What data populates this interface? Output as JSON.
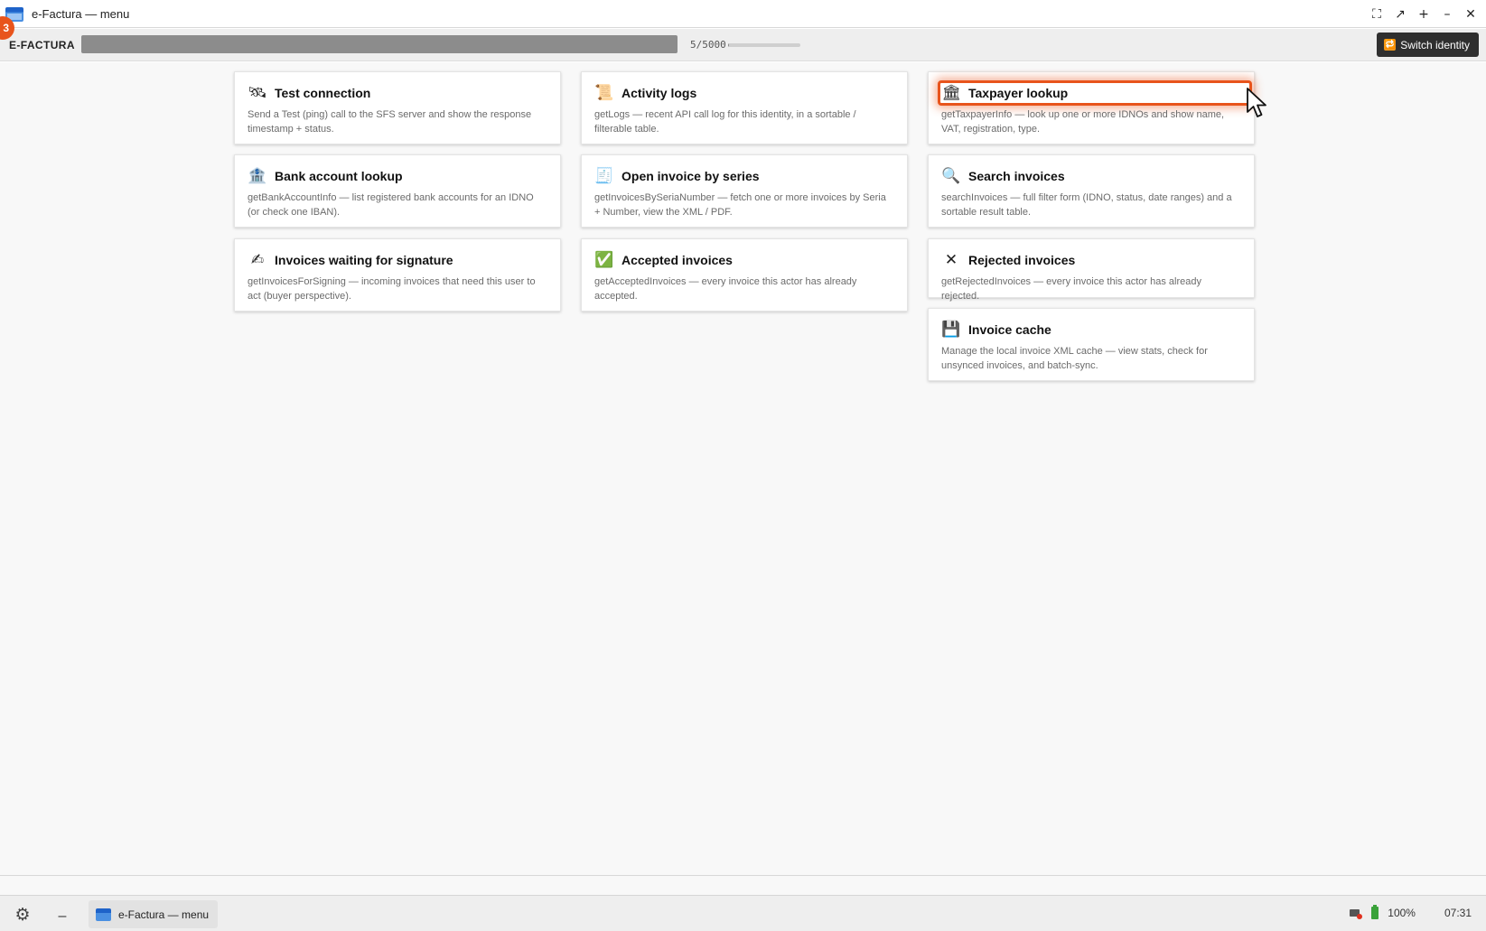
{
  "window": {
    "title": "e-Factura — menu",
    "icon": "folder-icon",
    "controls": {
      "fullscreen_icon": "⛶",
      "unmaximize_icon": "↗",
      "add_icon": "+",
      "minimize_icon": "–",
      "close_icon": "✕"
    }
  },
  "notification": {
    "badge": "3",
    "color": "#e8541c"
  },
  "appbar": {
    "brand": "E-FACTURA",
    "quota_text": "5/5000",
    "quota_fraction": 0.001,
    "switch_identity": {
      "icon": "🔁",
      "label": "Switch identity"
    }
  },
  "accent_color": "#e8541c",
  "cards": [
    {
      "id": "test-connection",
      "icon": "🛰",
      "title": "Test connection",
      "description": "Send a Test (ping) call to the SFS server and show the response timestamp + status."
    },
    {
      "id": "activity-logs",
      "icon": "📜",
      "title": "Activity logs",
      "description": "getLogs — recent API call log for this identity, in a sortable / filterable table."
    },
    {
      "id": "taxpayer-lookup",
      "icon": "🏛",
      "title": "Taxpayer lookup",
      "description": "getTaxpayerInfo — look up one or more IDNOs and show name, VAT, registration, type.",
      "highlighted": true
    },
    {
      "id": "bank-account-lookup",
      "icon": "🏦",
      "title": "Bank account lookup",
      "description": "getBankAccountInfo — list registered bank accounts for an IDNO (or check one IBAN)."
    },
    {
      "id": "open-invoice-by-series",
      "icon": "🧾",
      "title": "Open invoice by series",
      "description": "getInvoicesBySeriaNumber — fetch one or more invoices by Seria + Number, view the XML / PDF."
    },
    {
      "id": "search-invoices",
      "icon": "🔍",
      "title": "Search invoices",
      "description": "searchInvoices — full filter form (IDNO, status, date ranges) and a sortable result table."
    },
    {
      "id": "invoices-waiting-signature",
      "icon": "✍",
      "title": "Invoices waiting for signature",
      "description": "getInvoicesForSigning — incoming invoices that need this user to act (buyer perspective)."
    },
    {
      "id": "accepted-invoices",
      "icon": "✅",
      "title": "Accepted invoices",
      "description": "getAcceptedInvoices — every invoice this actor has already accepted."
    },
    {
      "id": "rejected-invoices",
      "icon": "✕",
      "title": "Rejected invoices",
      "description": "getRejectedInvoices — every invoice this actor has already rejected."
    },
    {
      "id": "invoice-cache",
      "icon": "💾",
      "title": "Invoice cache",
      "description": "Manage the local invoice XML cache — view stats, check for unsynced invoices, and batch-sync."
    }
  ],
  "taskbar": {
    "settings_icon": "⚙",
    "minimize_icon": "–",
    "task_label": "e-Factura — menu",
    "battery": "100%",
    "clock": "07:31"
  }
}
